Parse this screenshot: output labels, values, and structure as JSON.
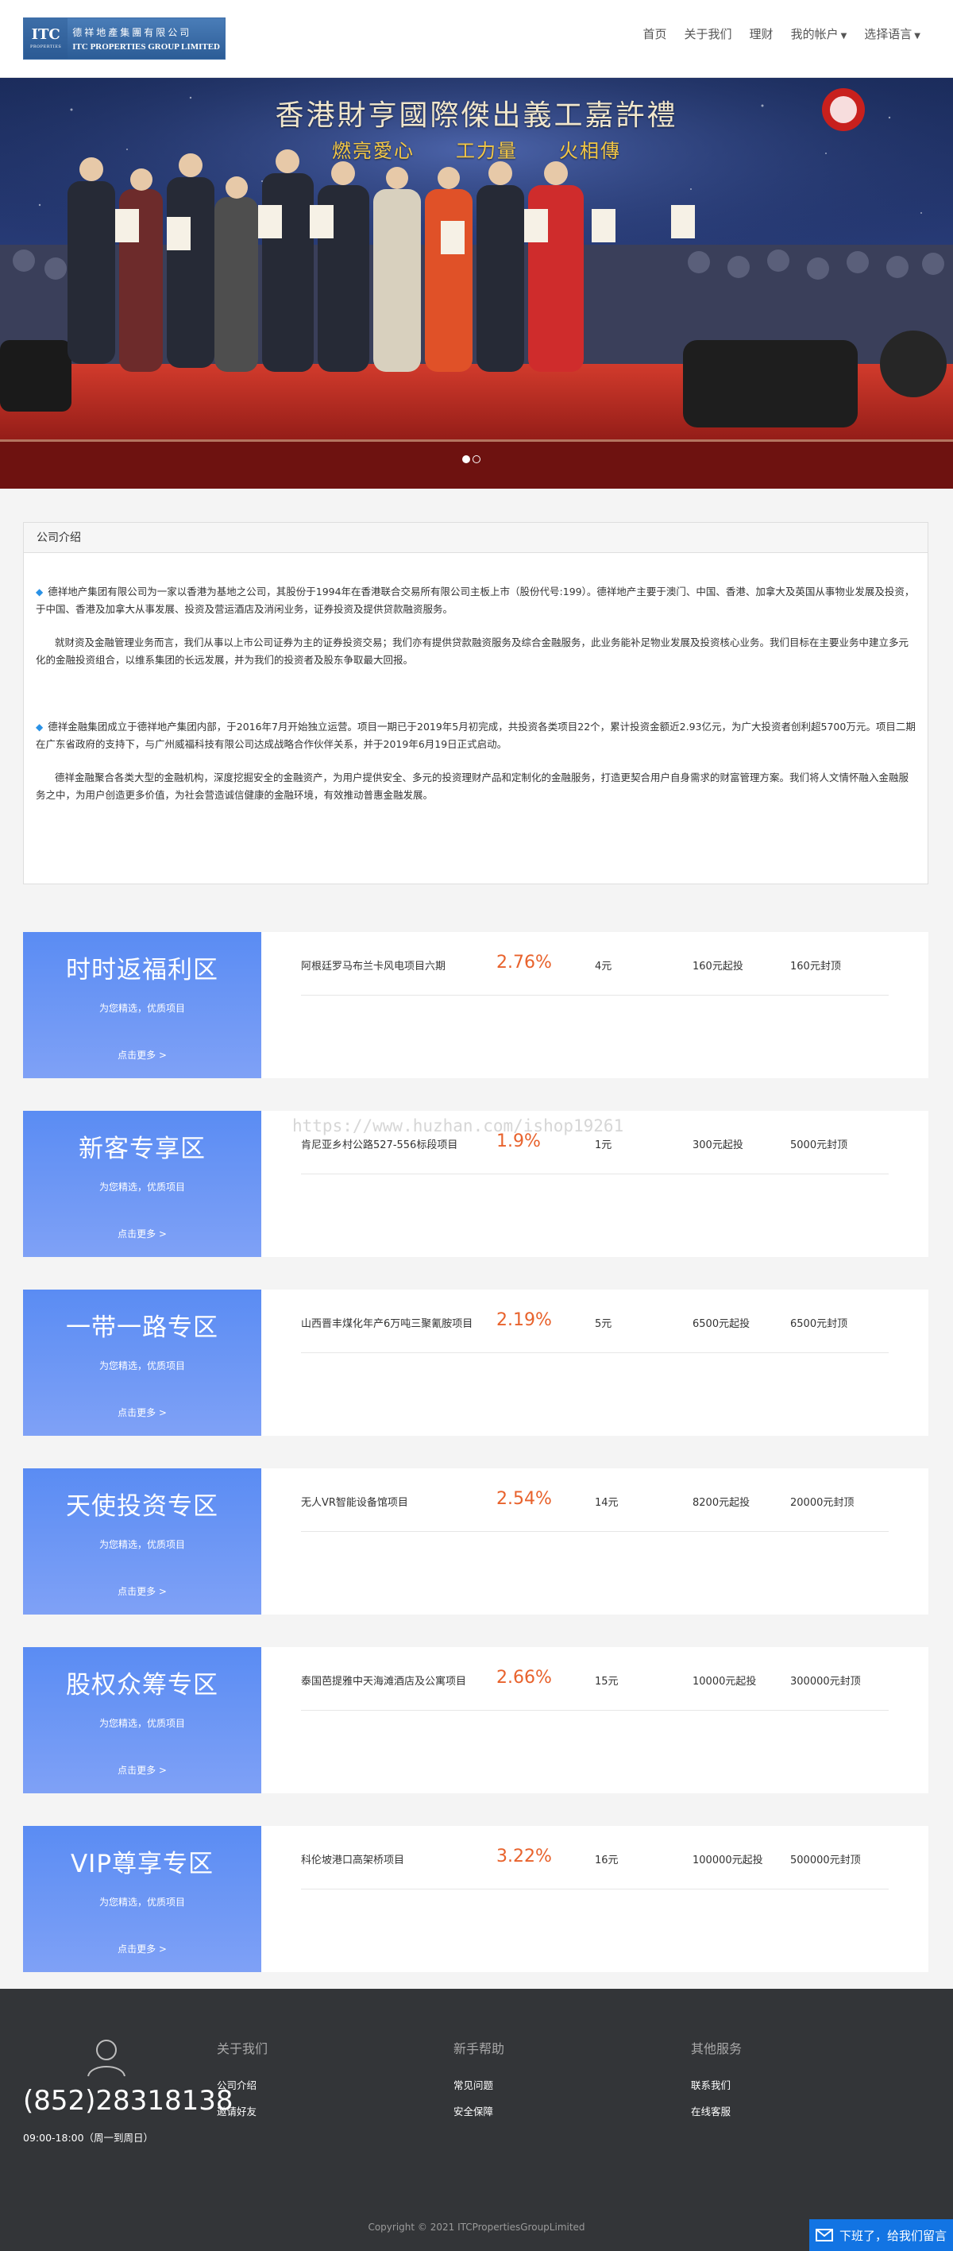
{
  "brand": {
    "mark": "ITC",
    "mark_sub": "PROPERTIES",
    "name_cn": "德祥地產集團有限公司",
    "name_en": "ITC PROPERTIES GROUP LIMITED"
  },
  "nav": {
    "items": [
      {
        "label": "首页"
      },
      {
        "label": "关于我们"
      },
      {
        "label": "理财"
      },
      {
        "label": "我的帐户",
        "dropdown": true
      },
      {
        "label": "选择语言",
        "dropdown": true
      }
    ]
  },
  "hero": {
    "title": "香港財亨國際傑出義工嘉許禮",
    "subtitle": "燃亮愛心　　工力量　　火相傳",
    "slides": 2,
    "active_slide": 1
  },
  "intro": {
    "heading": "公司介绍",
    "paragraphs": [
      "德祥地产集团有限公司为一家以香港为基地之公司，其股份于1994年在香港联合交易所有限公司主板上市（股份代号:199）。德祥地产主要于澳门、中国、香港、加拿大及英国从事物业发展及投资，于中国、香港及加拿大从事发展、投资及营运酒店及消闲业务，证券投资及提供贷款融资服务。",
      "就财资及金融管理业务而言，我们从事以上市公司证券为主的证券投资交易；我们亦有提供贷款融资服务及综合金融服务，此业务能补足物业发展及投资核心业务。我们目标在主要业务中建立多元化的金融投资组合，以维系集团的长远发展，并为我们的投资者及股东争取最大回报。",
      "德祥金融集团成立于德祥地产集团内部，于2016年7月开始独立运营。项目一期已于2019年5月初完成，共投资各类项目22个，累计投资金额近2.93亿元，为广大投资者创利超5700万元。项目二期在广东省政府的支持下，与广州威福科技有限公司达成战略合作伙伴关系，并于2019年6月19日正式启动。",
      "德祥金融聚合各类大型的金融机构，深度挖掘安全的金融资产，为用户提供安全、多元的投资理财产品和定制化的金融服务，打造更契合用户自身需求的财富管理方案。我们将人文情怀融入金融服务之中，为用户创造更多价值，为社会营造诚信健康的金融环境，有效推动普惠金融发展。"
    ]
  },
  "zones": [
    {
      "name": "时时返福利区",
      "slogan": "为您精选，优质项目",
      "more": "点击更多 >",
      "item": {
        "title": "阿根廷罗马布兰卡风电项目六期",
        "rate": "2.76%",
        "period": "4元",
        "min": "160元起投",
        "cap": "160元封顶"
      }
    },
    {
      "name": "新客专享区",
      "slogan": "为您精选，优质项目",
      "more": "点击更多 >",
      "item": {
        "title": "肯尼亚乡村公路527-556标段项目",
        "rate": "1.9%",
        "period": "1元",
        "min": "300元起投",
        "cap": "5000元封顶"
      }
    },
    {
      "name": "一带一路专区",
      "slogan": "为您精选，优质项目",
      "more": "点击更多 >",
      "item": {
        "title": "山西晋丰煤化年产6万吨三聚氰胺项目",
        "rate": "2.19%",
        "period": "5元",
        "min": "6500元起投",
        "cap": "6500元封顶"
      }
    },
    {
      "name": "天使投资专区",
      "slogan": "为您精选，优质项目",
      "more": "点击更多 >",
      "item": {
        "title": "无人VR智能设备馆项目",
        "rate": "2.54%",
        "period": "14元",
        "min": "8200元起投",
        "cap": "20000元封顶"
      }
    },
    {
      "name": "股权众筹专区",
      "slogan": "为您精选，优质项目",
      "more": "点击更多 >",
      "item": {
        "title": "泰国芭提雅中天海滩酒店及公寓项目",
        "rate": "2.66%",
        "period": "15元",
        "min": "10000元起投",
        "cap": "300000元封顶"
      }
    },
    {
      "name": "VIP尊享专区",
      "slogan": "为您精选，优质项目",
      "more": "点击更多 >",
      "item": {
        "title": "科伦坡港口高架桥项目",
        "rate": "3.22%",
        "period": "16元",
        "min": "100000元起投",
        "cap": "500000元封顶"
      }
    }
  ],
  "watermark": "https://www.huzhan.com/ishop19261",
  "footer": {
    "phone": "(852)28318138",
    "hours": "09:00-18:00（周一到周日）",
    "columns": [
      {
        "title": "关于我们",
        "links": [
          "公司介绍",
          "邀请好友"
        ]
      },
      {
        "title": "新手帮助",
        "links": [
          "常见问题",
          "安全保障"
        ]
      },
      {
        "title": "其他服务",
        "links": [
          "联系我们",
          "在线客服"
        ]
      }
    ],
    "copyright": "Copyright © 2021 ITCPropertiesGroupLimited"
  },
  "chat": {
    "label": "下班了，给我们留言"
  },
  "colors": {
    "accent_blue": "#5a8cf3",
    "rate_orange": "#e8622c",
    "footer_bg": "#333538",
    "chat_blue": "#1274e3"
  }
}
